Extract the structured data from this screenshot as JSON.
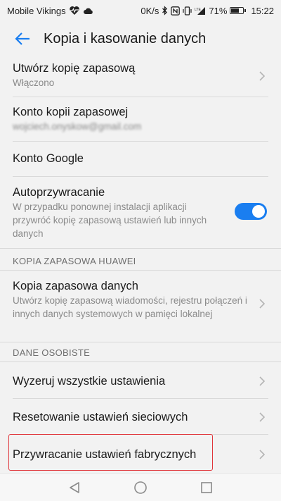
{
  "status_bar": {
    "carrier": "Mobile Vikings",
    "speed": "0K/s",
    "battery_percent": "71%",
    "battery_level": 0.71,
    "time": "15:22",
    "icons": [
      "heart-pulse-icon",
      "cloud-icon",
      "bluetooth-icon",
      "nfc-icon",
      "vibrate-icon",
      "lte-signal-icon",
      "battery-icon"
    ]
  },
  "app_bar": {
    "title": "Kopia i kasowanie danych",
    "back_icon": "arrow-left-icon"
  },
  "settings": {
    "backup": {
      "title": "Utwórz kopię zapasową",
      "subtitle": "Włączono"
    },
    "backup_account": {
      "title": "Konto kopii zapasowej",
      "subtitle": "wojciech.onyskow@gmail.com"
    },
    "google_account": {
      "title": "Konto Google"
    },
    "auto_restore": {
      "title": "Autoprzywracanie",
      "subtitle": "W przypadku ponownej instalacji aplikacji przywróć kopię zapasową ustawień lub innych danych",
      "enabled": true
    },
    "huawei_section": "KOPIA ZAPASOWA HUAWEI",
    "data_backup": {
      "title": "Kopia zapasowa danych",
      "subtitle": "Utwórz kopię zapasową wiadomości, rejestru połączeń i innych danych systemowych w pamięci lokalnej"
    },
    "personal_section": "DANE OSOBISTE",
    "reset_all": {
      "title": "Wyzeruj wszystkie ustawienia"
    },
    "network_reset": {
      "title": "Resetowanie ustawień sieciowych"
    },
    "factory_reset": {
      "title": "Przywracanie ustawień fabrycznych"
    }
  },
  "colors": {
    "accent": "#1a7ef0",
    "highlight": "#e0363b",
    "background": "#f2f2f2"
  }
}
